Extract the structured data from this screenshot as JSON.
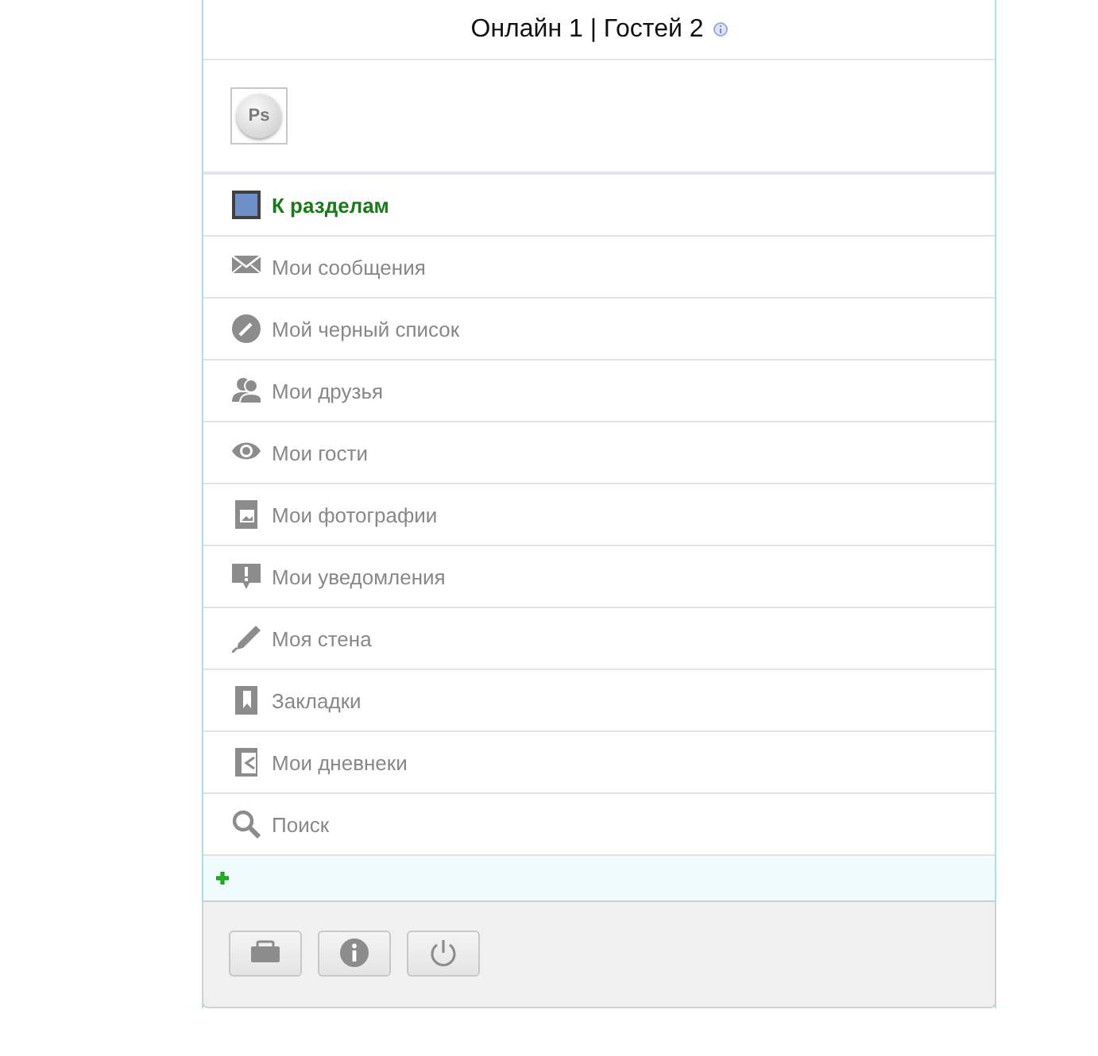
{
  "header": {
    "text": "Онлайн 1 | Гостей 2"
  },
  "avatar": {
    "label": "Ps"
  },
  "menu": [
    {
      "label": "К разделам",
      "kind": "back"
    },
    {
      "label": "Мои сообщения",
      "kind": "link"
    },
    {
      "label": "Мой черный список",
      "kind": "link"
    },
    {
      "label": "Мои друзья",
      "kind": "link"
    },
    {
      "label": "Мои гости",
      "kind": "link"
    },
    {
      "label": "Мои фотографии",
      "kind": "link"
    },
    {
      "label": "Мои уведомления",
      "kind": "link"
    },
    {
      "label": "Моя стена",
      "kind": "link"
    },
    {
      "label": "Закладки",
      "kind": "link"
    },
    {
      "label": "Мои дневнеки",
      "kind": "link"
    },
    {
      "label": "Поиск",
      "kind": "link"
    }
  ]
}
